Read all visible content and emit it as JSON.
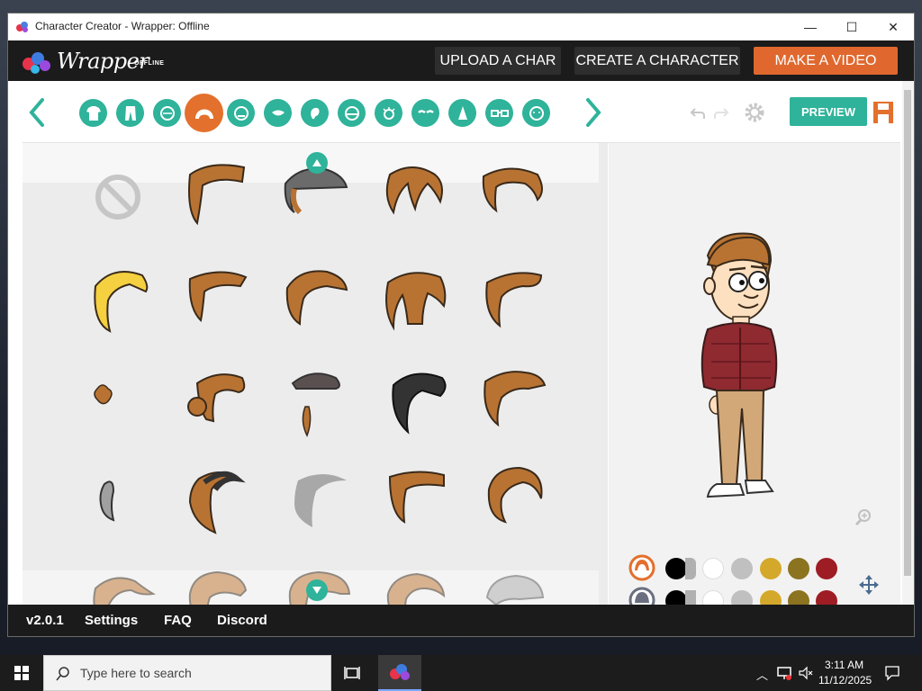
{
  "window": {
    "title": "Character Creator - Wrapper: Offline",
    "minimize_glyph": "—",
    "maximize_glyph": "☐",
    "close_glyph": "✕"
  },
  "header": {
    "logo_text": "Wrapper",
    "logo_sub": "OFFLINE",
    "upload_label": "UPLOAD A CHAR",
    "create_label": "CREATE A CHARACTER",
    "video_label": "MAKE A VIDEO"
  },
  "tabs": {
    "items": [
      {
        "name": "upper-body-tab-icon"
      },
      {
        "name": "lower-body-tab-icon"
      },
      {
        "name": "face-tab-icon"
      },
      {
        "name": "hair-tab-icon",
        "active": true
      },
      {
        "name": "head-shape-tab-icon"
      },
      {
        "name": "mouth-tab-icon"
      },
      {
        "name": "ear-tab-icon"
      },
      {
        "name": "eye-tab-icon"
      },
      {
        "name": "eye-detail-tab-icon"
      },
      {
        "name": "eyebrow-tab-icon"
      },
      {
        "name": "nose-tab-icon"
      },
      {
        "name": "glasses-tab-icon"
      },
      {
        "name": "facial-hair-tab-icon"
      }
    ],
    "preview_label": "PREVIEW"
  },
  "colors": {
    "accent": "#2fb39a",
    "brand_orange": "#e3702c",
    "hair_brown": "#b87333",
    "swatches": [
      "#000000",
      "#ffffff",
      "#c0c0c0",
      "#d4a82a",
      "#8b7320",
      "#9e1c24"
    ]
  },
  "footer": {
    "version": "v2.0.1",
    "settings": "Settings",
    "faq": "FAQ",
    "discord": "Discord"
  },
  "taskbar": {
    "search_placeholder": "Type here to search",
    "time": "3:11 AM",
    "date": "11/12/2025"
  }
}
